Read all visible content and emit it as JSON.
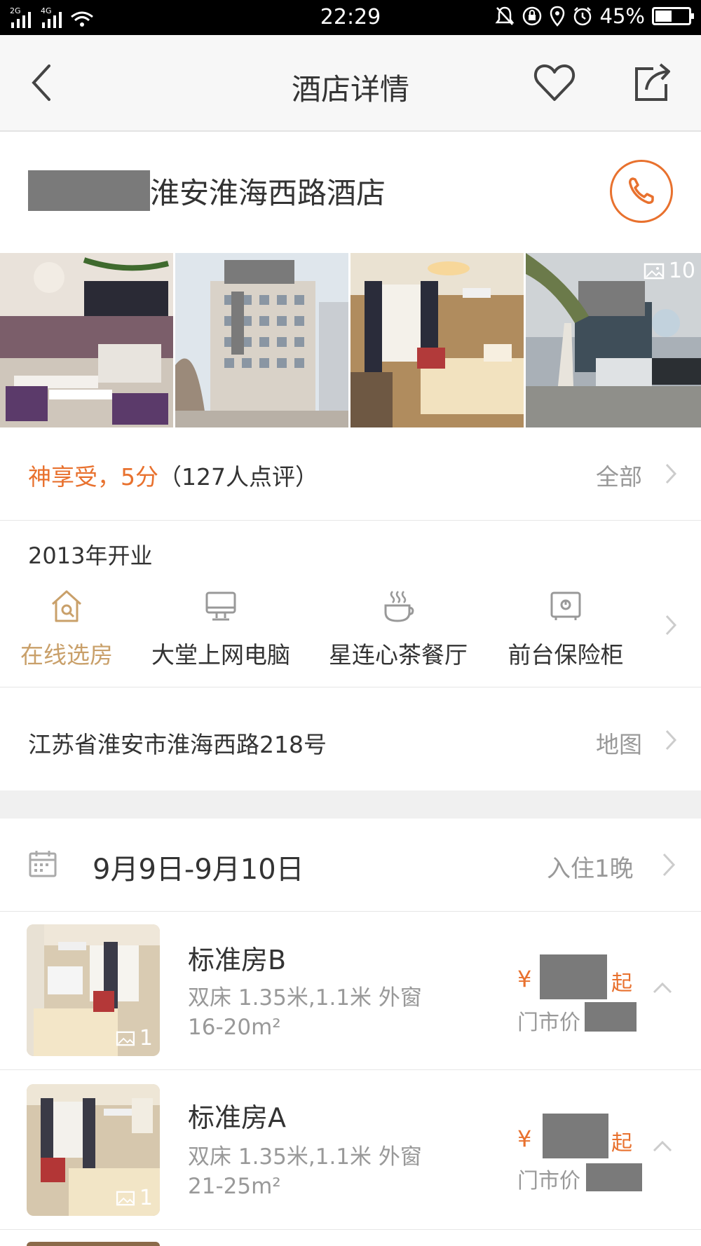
{
  "status_bar": {
    "signal_left": "2G 4G",
    "time": "22:29",
    "battery_percent": "45%",
    "battery_level": 0.45
  },
  "nav": {
    "title": "酒店详情"
  },
  "hotel": {
    "name": "淮安淮海西路酒店"
  },
  "photos": {
    "count": "10"
  },
  "reviews": {
    "rating_text": "神享受，5分",
    "count_text": "（127人点评）",
    "all_label": "全部"
  },
  "opened": "2013年开业",
  "amenities": [
    {
      "label": "在线选房",
      "icon": "house-search-icon",
      "active": true
    },
    {
      "label": "大堂上网电脑",
      "icon": "computer-icon",
      "active": false
    },
    {
      "label": "星连心茶餐厅",
      "icon": "tea-cup-icon",
      "active": false
    },
    {
      "label": "前台保险柜",
      "icon": "safe-icon",
      "active": false
    }
  ],
  "address": {
    "text": "江苏省淮安市淮海西路218号",
    "map_label": "地图"
  },
  "dates": {
    "range": "9月9日-9月10日",
    "nights": "入住1晚"
  },
  "rooms": [
    {
      "name": "标准房B",
      "beds": "双床 1.35米,1.1米  外窗",
      "area": "16-20m²",
      "currency": "¥",
      "from_label": "起",
      "market_label": "门市价",
      "photo_count": "1"
    },
    {
      "name": "标准房A",
      "beds": "双床 1.35米,1.1米  外窗",
      "area": "21-25m²",
      "currency": "¥",
      "from_label": "起",
      "market_label": "门市价",
      "photo_count": "1"
    }
  ],
  "colors": {
    "accent": "#e8712e",
    "gold": "#c9a06a",
    "redaction": "#7a7a7a"
  }
}
